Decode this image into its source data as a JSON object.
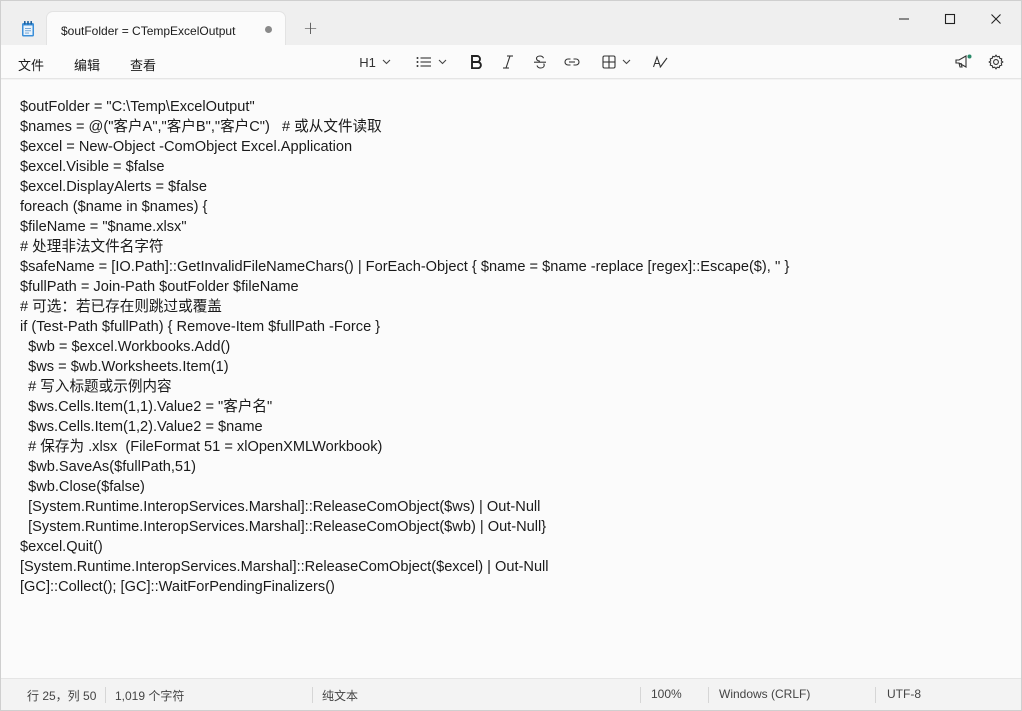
{
  "tab": {
    "title": "$outFolder = CTempExcelOutput"
  },
  "menu": [
    "文件",
    "编辑",
    "查看"
  ],
  "toolbar": {
    "heading_label": "H1"
  },
  "code_lines": [
    "$outFolder = \"C:\\Temp\\ExcelOutput\"",
    "$names = @(\"客户A\",\"客户B\",\"客户C\")   # 或从文件读取",
    "$excel = New-Object -ComObject Excel.Application",
    "$excel.Visible = $false",
    "$excel.DisplayAlerts = $false",
    "foreach ($name in $names) {",
    "$fileName = \"$name.xlsx\"",
    "# 处理非法文件名字符",
    "$safeName = [IO.Path]::GetInvalidFileNameChars() | ForEach-Object { $name = $name -replace [regex]::Escape($), '' }",
    "$fullPath = Join-Path $outFolder $fileName",
    "# 可选：若已存在则跳过或覆盖",
    "if (Test-Path $fullPath) { Remove-Item $fullPath -Force }",
    "  $wb = $excel.Workbooks.Add()",
    "  $ws = $wb.Worksheets.Item(1)",
    "  # 写入标题或示例内容",
    "  $ws.Cells.Item(1,1).Value2 = \"客户名\"",
    "  $ws.Cells.Item(1,2).Value2 = $name",
    "  # 保存为 .xlsx  (FileFormat 51 = xlOpenXMLWorkbook)",
    "  $wb.SaveAs($fullPath,51)",
    "  $wb.Close($false)",
    "  [System.Runtime.InteropServices.Marshal]::ReleaseComObject($ws) | Out-Null",
    "  [System.Runtime.InteropServices.Marshal]::ReleaseComObject($wb) | Out-Null}",
    "$excel.Quit()",
    "[System.Runtime.InteropServices.Marshal]::ReleaseComObject($excel) | Out-Null",
    "[GC]::Collect(); [GC]::WaitForPendingFinalizers()"
  ],
  "status": {
    "position": "行 25，列 50",
    "char_count": "1,019 个字符",
    "format": "纯文本",
    "zoom": "100%",
    "line_ending": "Windows (CRLF)",
    "encoding": "UTF-8"
  }
}
